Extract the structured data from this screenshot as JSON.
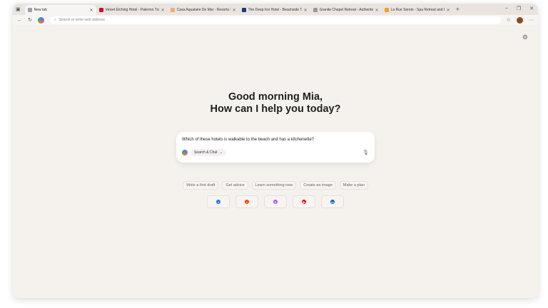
{
  "tabs": [
    {
      "title": "New tab",
      "color": "#9aa0a6"
    },
    {
      "title": "Velvet Etching Hotel - Palermo Tra",
      "color": "#c8102e"
    },
    {
      "title": "Casa Aqualaire De Mar - Resorts Hu",
      "color": "#e8b07a"
    },
    {
      "title": "The Deep Koi Hotel - Beachside Tra",
      "color": "#1f3a78"
    },
    {
      "title": "Granite Chapel Retreat - Authentic",
      "color": "#999999"
    },
    {
      "title": "La Rue Serein - Spa Retreat and Ho",
      "color": "#f0a020"
    }
  ],
  "address": {
    "placeholder": "Search or enter web address"
  },
  "greeting": {
    "line1": "Good morning Mia,",
    "line2": "How can I help you today?"
  },
  "prompt": {
    "text": "Which of these hotels is walkable to the beach and has a kitchenette?",
    "mode": "Search & Chat"
  },
  "chips": [
    "Write a first draft",
    "Get advice",
    "Learn something new",
    "Create an image",
    "Make a plan"
  ],
  "sites": [
    {
      "name": "facebook",
      "color": "#1877f2",
      "g": "f"
    },
    {
      "name": "reddit",
      "color": "#ff4500",
      "g": "r"
    },
    {
      "name": "figma",
      "color": "#a259ff",
      "g": "F"
    },
    {
      "name": "youtube",
      "color": "#ff0000",
      "g": "▶"
    },
    {
      "name": "linkedin",
      "color": "#0a66c2",
      "g": "in"
    }
  ]
}
